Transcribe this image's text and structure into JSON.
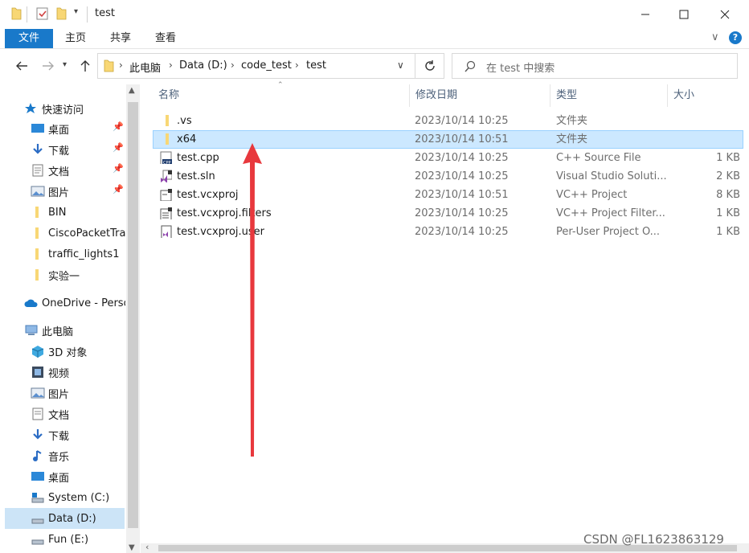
{
  "window": {
    "title": "test"
  },
  "ribbon": {
    "tabs": [
      "文件",
      "主页",
      "共享",
      "查看"
    ]
  },
  "address": {
    "crumbs": [
      "此电脑",
      "Data (D:)",
      "code_test",
      "test"
    ]
  },
  "search": {
    "placeholder": "在 test 中搜索"
  },
  "nav": {
    "quick_access": "快速访问",
    "items": [
      {
        "label": "桌面",
        "icon": "desktop-icon",
        "pinned": true
      },
      {
        "label": "下载",
        "icon": "download-icon",
        "pinned": true
      },
      {
        "label": "文档",
        "icon": "documents-icon",
        "pinned": true
      },
      {
        "label": "图片",
        "icon": "pictures-icon",
        "pinned": true
      },
      {
        "label": "BIN",
        "icon": "folder-icon",
        "pinned": false
      },
      {
        "label": "CiscoPacketTra",
        "icon": "folder-icon",
        "pinned": false
      },
      {
        "label": "traffic_lights1",
        "icon": "folder-icon",
        "pinned": false
      },
      {
        "label": "实验一",
        "icon": "folder-icon",
        "pinned": false
      }
    ],
    "onedrive": "OneDrive - Perso",
    "this_pc": "此电脑",
    "pc_items": [
      {
        "label": "3D 对象",
        "icon": "3d-objects-icon"
      },
      {
        "label": "视频",
        "icon": "videos-icon"
      },
      {
        "label": "图片",
        "icon": "pictures-icon"
      },
      {
        "label": "文档",
        "icon": "documents-icon"
      },
      {
        "label": "下载",
        "icon": "download-icon"
      },
      {
        "label": "音乐",
        "icon": "music-icon"
      },
      {
        "label": "桌面",
        "icon": "desktop-icon"
      },
      {
        "label": "System (C:)",
        "icon": "drive-c-icon"
      },
      {
        "label": "Data (D:)",
        "icon": "drive-d-icon"
      },
      {
        "label": "Fun (E:)",
        "icon": "drive-e-icon"
      }
    ]
  },
  "columns": {
    "name": "名称",
    "modified": "修改日期",
    "type": "类型",
    "size": "大小"
  },
  "files": [
    {
      "name": ".vs",
      "modified": "2023/10/14 10:25",
      "type": "文件夹",
      "size": "",
      "icon": "folder-icon"
    },
    {
      "name": "x64",
      "modified": "2023/10/14 10:51",
      "type": "文件夹",
      "size": "",
      "icon": "folder-icon",
      "selected": true
    },
    {
      "name": "test.cpp",
      "modified": "2023/10/14 10:25",
      "type": "C++ Source File",
      "size": "1 KB",
      "icon": "cpp-file-icon"
    },
    {
      "name": "test.sln",
      "modified": "2023/10/14 10:25",
      "type": "Visual Studio Soluti...",
      "size": "2 KB",
      "icon": "sln-file-icon"
    },
    {
      "name": "test.vcxproj",
      "modified": "2023/10/14 10:51",
      "type": "VC++ Project",
      "size": "8 KB",
      "icon": "vcxproj-file-icon"
    },
    {
      "name": "test.vcxproj.filters",
      "modified": "2023/10/14 10:25",
      "type": "VC++ Project Filter...",
      "size": "1 KB",
      "icon": "filters-file-icon"
    },
    {
      "name": "test.vcxproj.user",
      "modified": "2023/10/14 10:25",
      "type": "Per-User Project O...",
      "size": "1 KB",
      "icon": "user-file-icon"
    }
  ],
  "watermark": "CSDN @FL1623863129",
  "colors": {
    "accent": "#1979ca",
    "selection": "#cce8ff",
    "folder": "#f8d775",
    "arrow": "#e8383d"
  }
}
